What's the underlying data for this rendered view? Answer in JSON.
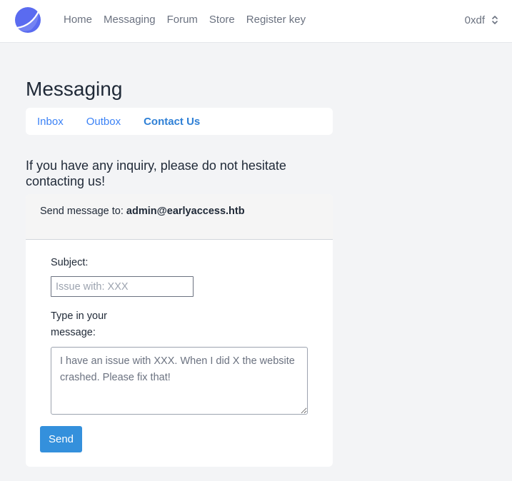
{
  "nav": {
    "items": [
      {
        "label": "Home"
      },
      {
        "label": "Messaging"
      },
      {
        "label": "Forum"
      },
      {
        "label": "Store"
      },
      {
        "label": "Register key"
      }
    ]
  },
  "user": {
    "name": "0xdf"
  },
  "page": {
    "title": "Messaging"
  },
  "tabs": [
    {
      "label": "Inbox",
      "active": false
    },
    {
      "label": "Outbox",
      "active": false
    },
    {
      "label": "Contact Us",
      "active": true
    }
  ],
  "intro": "If you have any inquiry, please do not hesitate contacting us!",
  "card": {
    "send_to_label": "Send message to:",
    "recipient": "admin@earlyaccess.htb",
    "subject_label": "Subject:",
    "subject_placeholder": "Issue with: XXX",
    "subject_value": "",
    "message_label_line1": "Type in your",
    "message_label_line2": "message:",
    "message_placeholder": "I have an issue with XXX. When I did X the website crashed. Please fix that!",
    "message_value": "",
    "send_label": "Send"
  },
  "colors": {
    "accent": "#3490dc",
    "background": "#f3f4f6",
    "logo": "#5a6bf0"
  },
  "icons": {
    "logo": "crescent-logo-icon",
    "user_menu": "chevron-up-down-icon"
  }
}
